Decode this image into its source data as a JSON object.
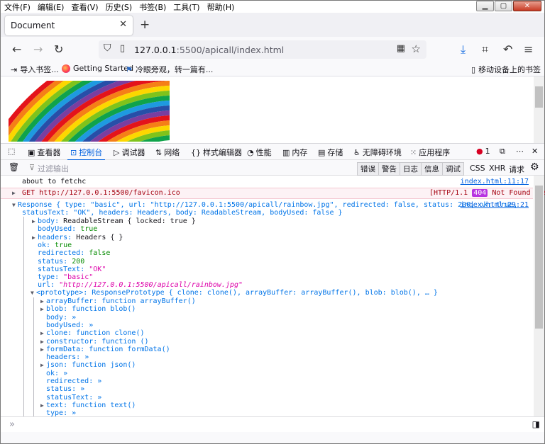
{
  "menu": [
    "文件(F)",
    "编辑(E)",
    "查看(V)",
    "历史(S)",
    "书签(B)",
    "工具(T)",
    "帮助(H)"
  ],
  "tab": {
    "title": "Document"
  },
  "url": {
    "host": "127.0.0.1",
    "path": ":5500/apicall/index.html"
  },
  "bookmarks": [
    "导入书签...",
    "Getting Started",
    "冷眼旁观，转一篇有...",
    "移动设备上的书签"
  ],
  "devtools": {
    "tabs": [
      "查看器",
      "控制台",
      "调试器",
      "网络",
      "样式编辑器",
      "性能",
      "内存",
      "存储",
      "无障碍环境",
      "应用程序"
    ],
    "error_count": "1",
    "filter_placeholder": "过滤输出",
    "levels": [
      "错误",
      "警告",
      "日志",
      "信息",
      "调试"
    ],
    "right_filters": [
      "CSS",
      "XHR",
      "请求"
    ]
  },
  "console": {
    "log1": {
      "text": "about to fetchc",
      "loc": "index.html:11:17"
    },
    "net": {
      "text": "GET http://127.0.0.1:5500/favicon.ico",
      "status_pre": "[HTTP/1.1",
      "code": "404",
      "status_post": "Not Found 0ms]"
    },
    "resp_head_1": "Response { type: \"basic\", url: \"http://127.0.0.1:5500/apicall/rainbow.jpg\", redirected: false, status: 200, ok: true,",
    "resp_head_2": "statusText: \"OK\", headers: Headers, body: ReadableStream, bodyUsed: false }",
    "resp_loc": "index.html:29:21",
    "props": [
      {
        "t": true,
        "k": "body:",
        "v": "ReadableStream { locked: true }",
        "c": "g"
      },
      {
        "t": false,
        "k": "bodyUsed:",
        "v": "true",
        "c": "n"
      },
      {
        "t": true,
        "k": "headers:",
        "v": "Headers {  }",
        "c": "g"
      },
      {
        "t": false,
        "k": "ok:",
        "v": "true",
        "c": "n"
      },
      {
        "t": false,
        "k": "redirected:",
        "v": "false",
        "c": "n"
      },
      {
        "t": false,
        "k": "status:",
        "v": "200",
        "c": "n"
      },
      {
        "t": false,
        "k": "statusText:",
        "v": "\"OK\"",
        "c": "s"
      },
      {
        "t": false,
        "k": "type:",
        "v": "\"basic\"",
        "c": "s"
      },
      {
        "t": false,
        "k": "url:",
        "v": "\"http://127.0.0.1:5500/apicall/rainbow.jpg\"",
        "c": "si"
      }
    ],
    "proto": "<prototype>: ResponsePrototype { clone: clone(), arrayBuffer: arrayBuffer(), blob: blob(), … }",
    "proto_props": [
      {
        "t": true,
        "k": "arrayBuffer:",
        "v": "function arrayBuffer()"
      },
      {
        "t": true,
        "k": "blob:",
        "v": "function blob()"
      },
      {
        "t": false,
        "k": "body:",
        "v": "»"
      },
      {
        "t": false,
        "k": "bodyUsed:",
        "v": "»"
      },
      {
        "t": true,
        "k": "clone:",
        "v": "function clone()"
      },
      {
        "t": true,
        "k": "constructor:",
        "v": "function ()"
      },
      {
        "t": true,
        "k": "formData:",
        "v": "function formData()"
      },
      {
        "t": false,
        "k": "headers:",
        "v": "»"
      },
      {
        "t": true,
        "k": "json:",
        "v": "function json()"
      },
      {
        "t": false,
        "k": "ok:",
        "v": "»"
      },
      {
        "t": false,
        "k": "redirected:",
        "v": "»"
      },
      {
        "t": false,
        "k": "status:",
        "v": "»"
      },
      {
        "t": false,
        "k": "statusText:",
        "v": "»"
      },
      {
        "t": true,
        "k": "text:",
        "v": "function text()"
      },
      {
        "t": false,
        "k": "type:",
        "v": "»"
      }
    ],
    "prompt": "»"
  },
  "colors": {
    "accent": "#0060df",
    "error": "#a4000f",
    "string": "#dd00a9",
    "number": "#058b00",
    "key": "#0074e8"
  }
}
